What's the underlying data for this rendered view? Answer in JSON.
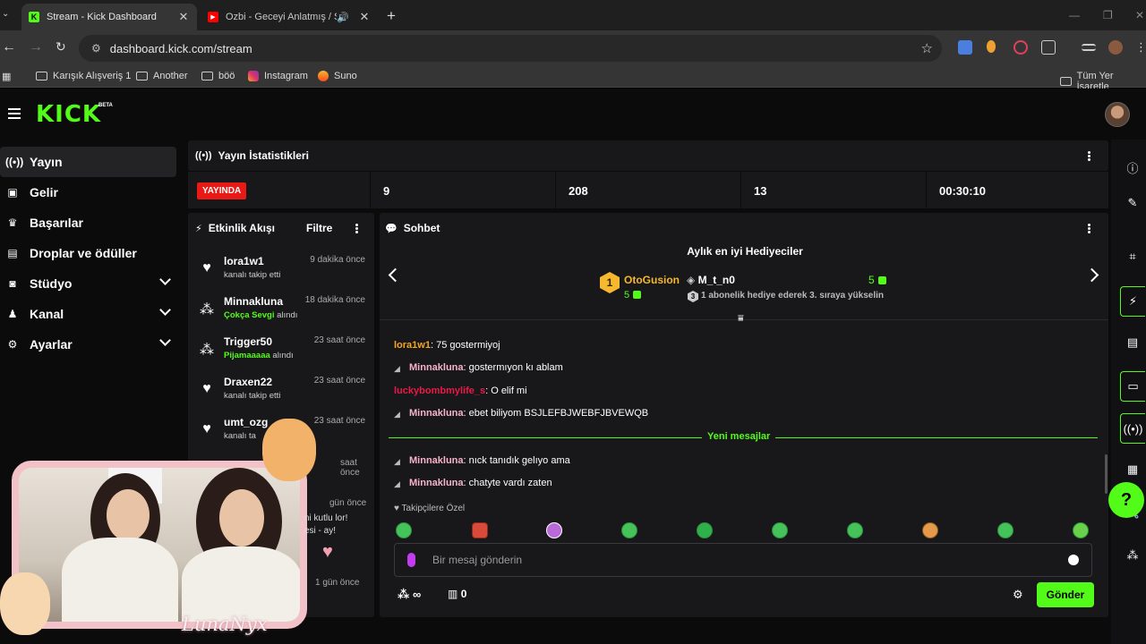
{
  "browser": {
    "tabs": [
      {
        "title": "Stream - Kick Dashboard",
        "favicon": "kick-icon",
        "active": true
      },
      {
        "title": "Ozbi - Geceyi Anlatmış / St",
        "favicon": "youtube-icon",
        "active": false
      }
    ],
    "url": "dashboard.kick.com/stream",
    "bookmarks": [
      "Karışık Alışveriş 1",
      "Another",
      "böö",
      "Instagram",
      "Suno"
    ],
    "bookmarks_right": "Tüm Yer İşaretle"
  },
  "kick": {
    "logo": "KICK",
    "beta": "BETA",
    "accent": "#53fc18",
    "sidebar": [
      {
        "label": "Yayın",
        "icon": "broadcast-icon",
        "active": true
      },
      {
        "label": "Gelir",
        "icon": "revenue-icon"
      },
      {
        "label": "Başarılar",
        "icon": "trophy-icon"
      },
      {
        "label": "Droplar ve ödüller",
        "icon": "gift-icon"
      },
      {
        "label": "Stüdyo",
        "icon": "studio-icon",
        "expandable": true
      },
      {
        "label": "Kanal",
        "icon": "channel-icon",
        "expandable": true
      },
      {
        "label": "Ayarlar",
        "icon": "settings-icon",
        "expandable": true
      }
    ],
    "stats": {
      "title": "Yayın İstatistikleri",
      "live_label": "YAYINDA",
      "values": [
        "9",
        "208",
        "13",
        "00:30:10"
      ]
    },
    "activity": {
      "title": "Etkinlik Akışı",
      "filter": "Filtre",
      "items": [
        {
          "name": "lora1w1",
          "time": "9 dakika önce",
          "sub": "kanalı takip etti",
          "highlight": "",
          "icon": "heart"
        },
        {
          "name": "Minnakluna",
          "time": "18 dakika önce",
          "sub": "alındı",
          "highlight": "Çokça Sevgi",
          "icon": "gift"
        },
        {
          "name": "Trigger50",
          "time": "23 saat önce",
          "sub": "alındı",
          "highlight": "Pijamaaaaa",
          "icon": "gift"
        },
        {
          "name": "Draxen22",
          "time": "23 saat önce",
          "sub": "kanalı takip etti",
          "highlight": "",
          "icon": "heart"
        },
        {
          "name": "umt_ozg",
          "time": "23 saat önce",
          "sub": "kanalı ta",
          "highlight": "",
          "icon": "heart"
        }
      ],
      "partial_times": [
        "saat önce",
        "gün önce",
        "1 gün önce"
      ]
    },
    "chat": {
      "title": "Sohbet",
      "gifters_title": "Aylık en iyi Hediyeciler",
      "gifter1": {
        "rank": "1",
        "name": "OtoGusion",
        "count": "5"
      },
      "gifter2": {
        "name": "M_t_n0",
        "count": "5",
        "rank_hint": "3",
        "hint": "1 abonelik hediye ederek 3. sıraya yükselin"
      },
      "messages": [
        {
          "user": "lora1w1",
          "text": ": 75 gostermiyoj",
          "color": "#f5a623"
        },
        {
          "user": "Minnakluna",
          "text": ": gostermıyon kı ablam",
          "color": "#f7b3c8"
        },
        {
          "user": "luckybombmylife_s",
          "text": ": O elif mi",
          "color": "#e91948"
        },
        {
          "user": "Minnakluna",
          "text": ": ebet biliyom BSJLEFBJWEBFJBVEWQB",
          "color": "#f7b3c8"
        }
      ],
      "new_messages_label": "Yeni mesajlar",
      "messages_after": [
        {
          "user": "Minnakluna",
          "text": ": nıck tanıdık gelıyo ama",
          "color": "#f7b3c8"
        },
        {
          "user": "Minnakluna",
          "text": ": chatyte vardı zaten",
          "color": "#f7b3c8"
        }
      ],
      "followers_only": "Takipçilere Özel",
      "placeholder": "Bir mesaj gönderin",
      "points": "∞",
      "shop_count": "0",
      "send_label": "Gönder"
    }
  },
  "overlay": {
    "signature": "LunaNyx",
    "partial_texts": [
      "ni kutlu lor!",
      "esi - ay!"
    ]
  }
}
